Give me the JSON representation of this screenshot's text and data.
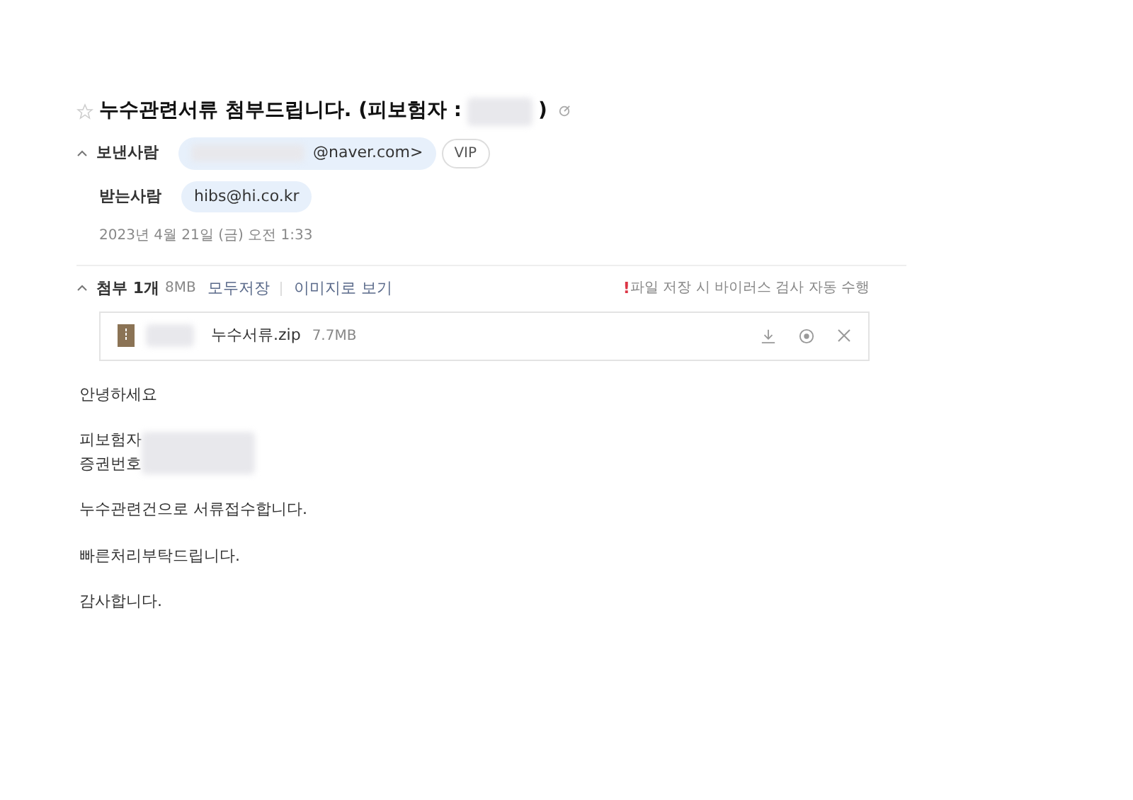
{
  "subject": {
    "starred": false,
    "text": "누수관련서류 첨부드립니다. (피보험자 :",
    "text_end": ")"
  },
  "header": {
    "expanded": true,
    "sender_label": "보낸사람",
    "sender_email": "@naver.com>",
    "vip": "VIP",
    "recipient_label": "받는사람",
    "recipient": "hibs@hi.co.kr",
    "date": "2023년 4월 21일 (금) 오전 1:33"
  },
  "attachments": {
    "expanded": true,
    "label": "첨부",
    "count": "1개",
    "size": "8MB",
    "save_all": "모두저장",
    "view_as_image": "이미지로 보기",
    "notice_mark": "!",
    "notice": "파일 저장 시 바이러스 검사 자동 수행",
    "files": [
      {
        "name": "누수서류.zip",
        "size": "7.7MB"
      }
    ]
  },
  "body": [
    {
      "lines": [
        "안녕하세요"
      ]
    },
    {
      "lines": [
        "피보험자",
        "증권번호"
      ],
      "redacted": true
    },
    {
      "lines": [
        "누수관련건으로 서류접수합니다."
      ]
    },
    {
      "lines": [
        "빠른처리부탁드립니다."
      ]
    },
    {
      "lines": [
        "감사합니다."
      ]
    }
  ]
}
